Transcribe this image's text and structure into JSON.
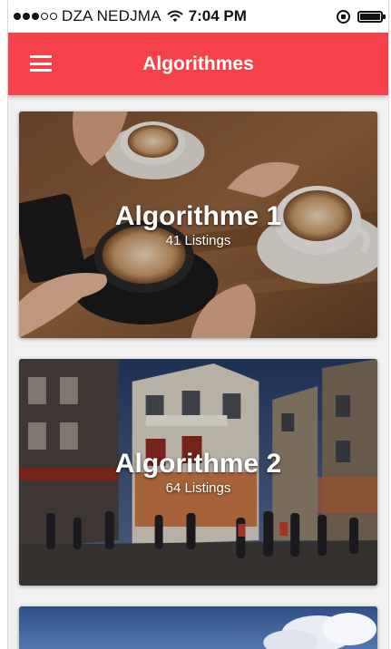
{
  "status_bar": {
    "carrier": "DZA NEDJMA",
    "time": "7:04 PM",
    "signal_icon": "signal-dots-icon",
    "wifi_icon": "wifi-icon",
    "rotation_lock_icon": "rotation-lock-icon",
    "battery_icon": "battery-icon"
  },
  "app_bar": {
    "title": "Algorithmes",
    "menu_icon": "hamburger-menu-icon",
    "color": "#f5424a"
  },
  "cards": [
    {
      "title": "Algorithme 1",
      "subtitle": "41 Listings",
      "image": "coffee-cups-photo"
    },
    {
      "title": "Algorithme 2",
      "subtitle": "64 Listings",
      "image": "paris-street-cafe-photo"
    },
    {
      "title": "",
      "subtitle": "",
      "image": "sky-clouds-photo"
    }
  ]
}
